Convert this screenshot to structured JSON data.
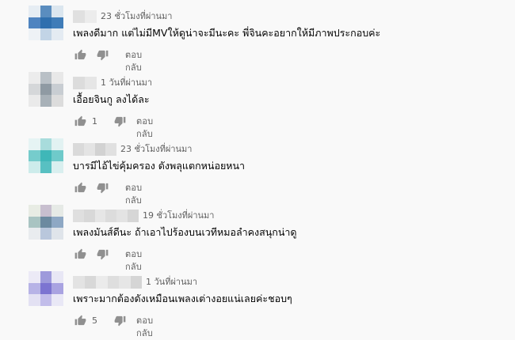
{
  "icons": {
    "like": "thumbs-up-icon",
    "dislike": "thumbs-down-icon"
  },
  "comments": [
    {
      "time": "23 ชั่วโมงที่ผ่านมา",
      "text": "เพลงดีมาก แต่ไม่มีMVให้ดูน่าจะมีนะคะ  พี่จินคะอยากให้มีภาพประกอบค่ะ",
      "likes": "",
      "reply": "ตอบกลับ",
      "avatar_colors": [
        "#e6edf3",
        "#5a8dbf",
        "#dbe6ef",
        "#4f84c0",
        "#2f6fae",
        "#3f7cb8",
        "#eef2f6",
        "#c2d4e6",
        "#e4ebf2"
      ],
      "author_colors": [
        "#e0e0e0",
        "#ececec",
        "#d6d6d6",
        "#e8e8e8",
        "#ebebeb",
        "#dedede",
        "#eeeeee",
        "#d3d3d3",
        "#e3e3e3",
        "#e9e9e9",
        "#dadada"
      ]
    },
    {
      "time": "1 วันที่ผ่านมา",
      "text": "เอื้อยจินกู ลงได้ละ",
      "likes": "1",
      "reply": "ตอบกลับ",
      "avatar_colors": [
        "#ececec",
        "#b9c0c6",
        "#e8e8e8",
        "#d5d7d9",
        "#8f9aa3",
        "#c8cdd2",
        "#eaeaea",
        "#a8b1b8",
        "#dcdcdc"
      ],
      "author_colors": [
        "#dcdcdc",
        "#e6e6e6",
        "#d8d8d8",
        "#e2e2e2",
        "#dddddd",
        "#e8e8e8",
        "#d9d9d9",
        "#e4e4e4",
        "#dfdfdf",
        "#eaeaea",
        "#dbdbdb"
      ]
    },
    {
      "time": "23 ชั่วโมงที่ผ่านมา",
      "text": "บารมีไอ้ไข่คุ้มครอง  ดังพลุแตกหน่อยหนา",
      "likes": "",
      "reply": "ตอบกลับ",
      "avatar_colors": [
        "#e6f4f4",
        "#a8dcdc",
        "#e2f2f2",
        "#76cccc",
        "#3fb7b8",
        "#6fcaca",
        "#cdeceb",
        "#58c0c2",
        "#d9efef"
      ],
      "author_colors": [
        "#dadada",
        "#e4e4e4",
        "#d2d2d2",
        "#e0e0e0",
        "#d7d7d7",
        "#e6e6e6",
        "#dcdcdc",
        "#e9e9e9",
        "#d5d5d5",
        "#e1e1e1",
        "#dddddd"
      ]
    },
    {
      "time": "19 ชั่วโมงที่ผ่านมา",
      "text": "เพลงมันส์ดีนะ  ถ้าเอาไปร้องบนเวทีหมอลำคงสนุกน่าดู",
      "likes": "",
      "reply": "ตอบกลับ",
      "avatar_colors": [
        "#e8ece4",
        "#c8bfcf",
        "#e6eae6",
        "#a9c4c2",
        "#6c8aa0",
        "#8ea8c4",
        "#e9ecef",
        "#b9c7dc",
        "#dfe4ea"
      ],
      "author_colors": [
        "#dfdfdf",
        "#d8d8d8",
        "#e6e6e6",
        "#dcdcdc",
        "#e3e3e3",
        "#d6d6d6",
        "#e9e9e9",
        "#dadada",
        "#e2e2e2",
        "#ececec",
        "#dedede"
      ]
    },
    {
      "time": "1 วันที่ผ่านมา",
      "text": "เพราะมากต้องดังเหมือนเพลงเต่างอยแน่เลยค่ะชอบๆ",
      "likes": "5",
      "reply": "ตอบกลับ",
      "avatar_colors": [
        "#eceaf6",
        "#9e9adb",
        "#e8e7f5",
        "#b7b3e6",
        "#7c74d1",
        "#a9a3e1",
        "#e3e1f3",
        "#c2bdea",
        "#e9e8f6"
      ],
      "author_colors": [
        "#e3e3e3",
        "#d8d8d8",
        "#ebebeb",
        "#dedede",
        "#e6e6e6",
        "#d5d5d5",
        "#e9e9e9",
        "#dcdcdc",
        "#e2e2e2",
        "#eeeeee",
        "#d9d9d9",
        "#e5e5e5",
        "#dbdbdb"
      ]
    }
  ]
}
